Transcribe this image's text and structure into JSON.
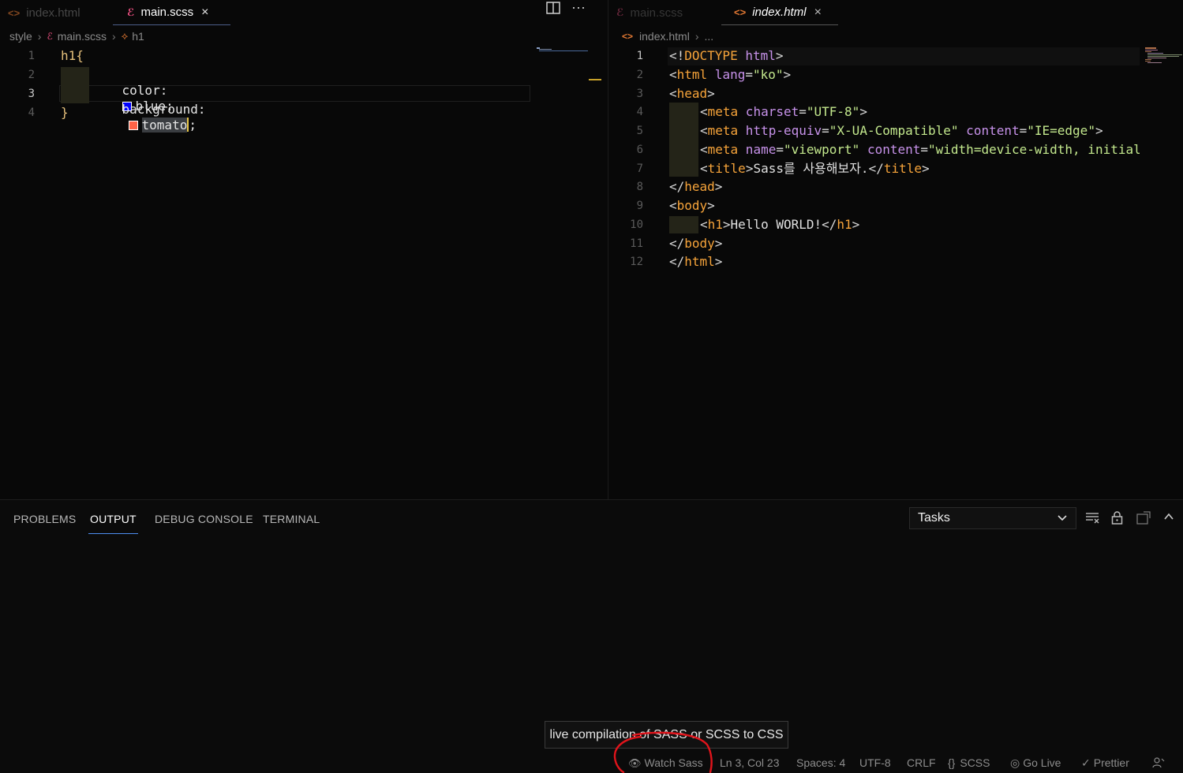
{
  "left_editor": {
    "tabs": [
      {
        "label": "index.html",
        "icon": "html-icon"
      },
      {
        "label": "main.scss",
        "icon": "sass-icon",
        "active": true,
        "close": "×"
      }
    ],
    "actions": {
      "split": "split-editor-icon",
      "more": "···"
    },
    "breadcrumb": [
      "style",
      "main.scss",
      "h1"
    ],
    "lines": [
      {
        "n": "1",
        "text": "h1{"
      },
      {
        "n": "2",
        "prop": "color:",
        "val": "blue;",
        "swatch": "#0000ff"
      },
      {
        "n": "3",
        "prop": "background:",
        "val": "tomato",
        "after": ";",
        "swatch": "#ff6347"
      },
      {
        "n": "4",
        "text": "}"
      }
    ]
  },
  "right_editor": {
    "tabs": [
      {
        "label": "main.scss",
        "icon": "sass-icon"
      },
      {
        "label": "index.html",
        "icon": "html-icon",
        "active": true,
        "close": "×"
      }
    ],
    "breadcrumb": [
      "index.html",
      "..."
    ],
    "line_numbers": [
      "1",
      "2",
      "3",
      "4",
      "5",
      "6",
      "7",
      "8",
      "9",
      "10",
      "11",
      "12"
    ],
    "code": {
      "l1": [
        "<!",
        "DOCTYPE",
        " html",
        ">"
      ],
      "l2": [
        "<",
        "html",
        " lang",
        "=",
        "\"ko\"",
        ">"
      ],
      "l3": [
        "<",
        "head",
        ">"
      ],
      "l4": [
        "<",
        "meta",
        " charset",
        "=",
        "\"UTF-8\"",
        ">"
      ],
      "l5": [
        "<",
        "meta",
        " http-equiv",
        "=",
        "\"X-UA-Compatible\"",
        " content",
        "=",
        "\"IE=edge\"",
        ">"
      ],
      "l6": [
        "<",
        "meta",
        " name",
        "=",
        "\"viewport\"",
        " content",
        "=",
        "\"width=device-width, initial"
      ],
      "l7": [
        "<",
        "title",
        ">",
        "Sass를 사용해보자.",
        "</",
        "title",
        ">"
      ],
      "l8": [
        "</",
        "head",
        ">"
      ],
      "l9": [
        "<",
        "body",
        ">"
      ],
      "l10": [
        "<",
        "h1",
        ">",
        "Hello WORLD!",
        "</",
        "h1",
        ">"
      ],
      "l11": [
        "</",
        "body",
        ">"
      ],
      "l12": [
        "</",
        "html",
        ">"
      ]
    }
  },
  "panel": {
    "tabs": [
      "PROBLEMS",
      "OUTPUT",
      "DEBUG CONSOLE",
      "TERMINAL"
    ],
    "active_tab": "OUTPUT",
    "select_value": "Tasks",
    "icons": [
      "clear-output-icon",
      "lock-icon",
      "open-in-editor-icon",
      "maximize-panel-icon"
    ]
  },
  "tooltip": "live compilation of SASS or SCSS to CSS",
  "statusbar": {
    "watch_sass": "Watch Sass",
    "position": "Ln 3, Col 23",
    "spaces": "Spaces: 4",
    "encoding": "UTF-8",
    "eol": "CRLF",
    "language": "SCSS",
    "go_live": "Go Live",
    "prettier": "Prettier"
  },
  "colors": {
    "annotation": "#e0141b",
    "accent": "#4d8df0"
  }
}
